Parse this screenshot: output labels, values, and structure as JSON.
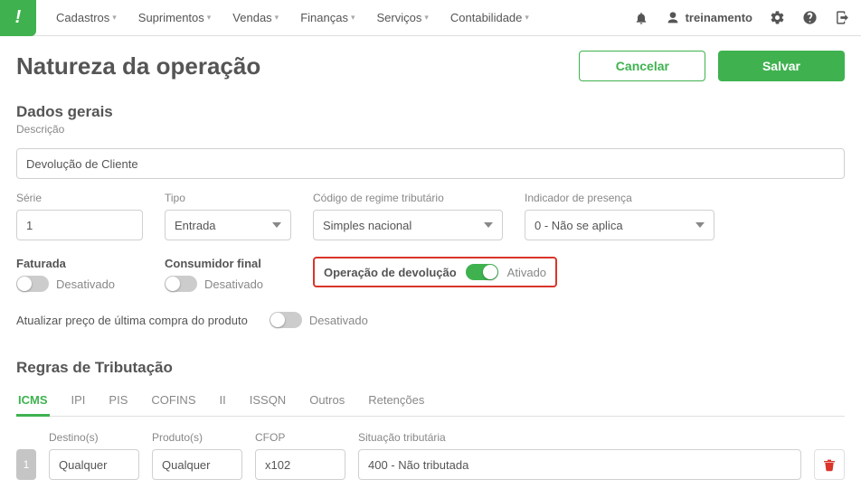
{
  "nav": {
    "items": [
      {
        "label": "Cadastros"
      },
      {
        "label": "Suprimentos"
      },
      {
        "label": "Vendas"
      },
      {
        "label": "Finanças"
      },
      {
        "label": "Serviços"
      },
      {
        "label": "Contabilidade"
      }
    ]
  },
  "user": {
    "name": "treinamento"
  },
  "page": {
    "title": "Natureza da operação",
    "cancel": "Cancelar",
    "save": "Salvar"
  },
  "section1": {
    "title": "Dados gerais",
    "descricao_label": "Descrição",
    "descricao_value": "Devolução de Cliente",
    "serie_label": "Série",
    "serie_value": "1",
    "tipo_label": "Tipo",
    "tipo_value": "Entrada",
    "regime_label": "Código de regime tributário",
    "regime_value": "Simples nacional",
    "indicador_label": "Indicador de presença",
    "indicador_value": "0 - Não se aplica",
    "faturada_label": "Faturada",
    "faturada_state": "Desativado",
    "consumidor_label": "Consumidor final",
    "consumidor_state": "Desativado",
    "devolucao_label": "Operação de devolução",
    "devolucao_state": "Ativado",
    "atualizar_preco_label": "Atualizar preço de última compra do produto",
    "atualizar_preco_state": "Desativado"
  },
  "section2": {
    "title": "Regras de Tributação",
    "tabs": [
      {
        "label": "ICMS"
      },
      {
        "label": "IPI"
      },
      {
        "label": "PIS"
      },
      {
        "label": "COFINS"
      },
      {
        "label": "II"
      },
      {
        "label": "ISSQN"
      },
      {
        "label": "Outros"
      },
      {
        "label": "Retenções"
      }
    ],
    "headers": {
      "destino": "Destino(s)",
      "produto": "Produto(s)",
      "cfop": "CFOP",
      "situacao": "Situação tributária"
    },
    "row": {
      "num": "1",
      "destino": "Qualquer",
      "produto": "Qualquer",
      "cfop": "x102",
      "situacao": "400 - Não tributada"
    }
  }
}
